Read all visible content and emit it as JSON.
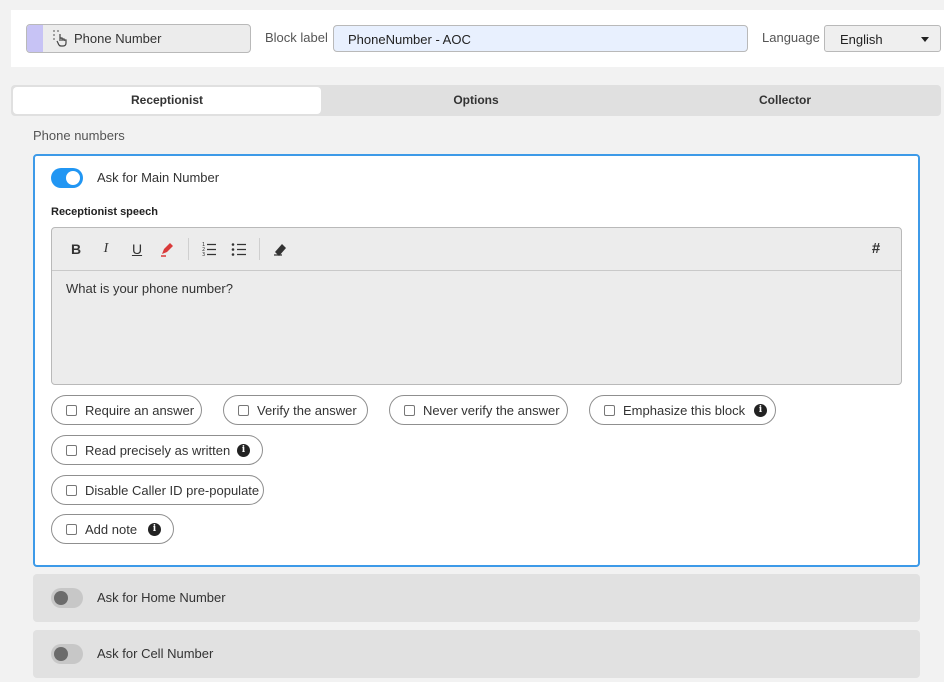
{
  "header": {
    "block_type": "Phone Number",
    "block_label_caption": "Block label",
    "block_label_value": "PhoneNumber - AOC",
    "language_caption": "Language",
    "language_value": "English"
  },
  "tabs": [
    {
      "label": "Receptionist",
      "active": true
    },
    {
      "label": "Options",
      "active": false
    },
    {
      "label": "Collector",
      "active": false
    }
  ],
  "section_title": "Phone numbers",
  "main_number": {
    "toggle_label": "Ask for Main Number",
    "enabled": true,
    "speech_label": "Receptionist speech",
    "speech_text": "What is your phone number?",
    "toolbar": {
      "bold": "B",
      "italic": "I",
      "underline": "U",
      "hash": "#",
      "icons": [
        "bold-icon",
        "italic-icon",
        "underline-icon",
        "highlighter-icon",
        "ordered-list-icon",
        "bullet-list-icon",
        "eraser-icon",
        "hash-icon"
      ]
    },
    "options": [
      {
        "label": "Require an answer",
        "checked": false,
        "info": false
      },
      {
        "label": "Verify the answer",
        "checked": false,
        "info": false
      },
      {
        "label": "Never verify the answer",
        "checked": false,
        "info": false
      },
      {
        "label": "Emphasize this block",
        "checked": false,
        "info": true
      },
      {
        "label": "Read precisely as written",
        "checked": false,
        "info": true
      },
      {
        "label": "Disable Caller ID pre-populate",
        "checked": false,
        "info": false
      },
      {
        "label": "Add note",
        "checked": false,
        "info": true
      }
    ],
    "info_glyph": "i"
  },
  "home_number": {
    "toggle_label": "Ask for Home Number",
    "enabled": false
  },
  "cell_number": {
    "toggle_label": "Ask for Cell Number",
    "enabled": false
  },
  "colors": {
    "accent": "#2196f3",
    "block_accent": "#c7c3f5",
    "highlighter": "#d93a3a"
  }
}
